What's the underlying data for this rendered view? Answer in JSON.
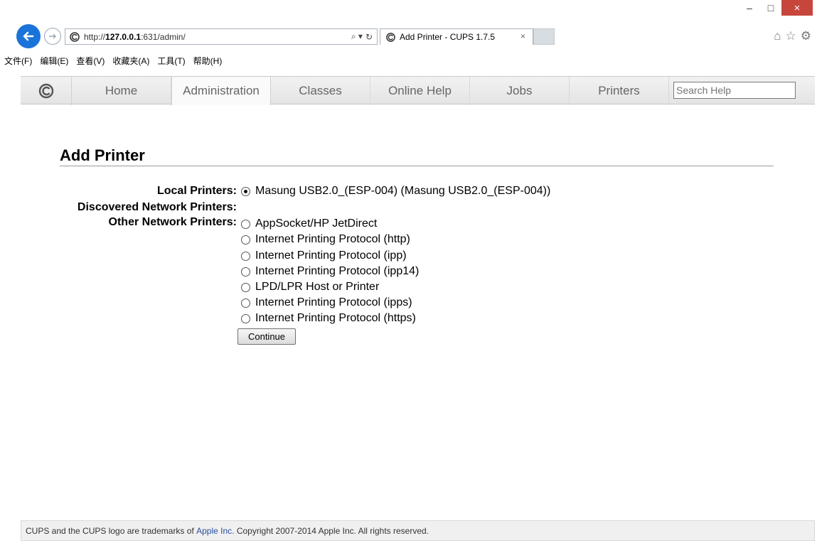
{
  "browser": {
    "url_prefix": "http://",
    "url_host": "127.0.0.1",
    "url_rest": ":631/admin/",
    "tab_title": "Add Printer - CUPS 1.7.5",
    "tab_close": "×",
    "search_tool": "⌕ ▾",
    "refresh_tool": "↻",
    "minimize": "–",
    "maximize": "□",
    "close": "×",
    "home_icon": "⌂",
    "star_icon": "☆",
    "gear_icon": "⚙"
  },
  "menu": [
    "文件(F)",
    "编辑(E)",
    "查看(V)",
    "收藏夹(A)",
    "工具(T)",
    "帮助(H)"
  ],
  "nav": {
    "tabs": [
      "Home",
      "Administration",
      "Classes",
      "Online Help",
      "Jobs",
      "Printers"
    ],
    "active": "Administration",
    "search_placeholder": "Search Help"
  },
  "page": {
    "title": "Add Printer",
    "local_label": "Local Printers:",
    "discovered_label": "Discovered Network Printers:",
    "other_label": "Other Network Printers:",
    "local_options": [
      "Masung USB2.0_(ESP-004) (Masung USB2.0_(ESP-004))"
    ],
    "other_options": [
      "AppSocket/HP JetDirect",
      "Internet Printing Protocol (http)",
      "Internet Printing Protocol (ipp)",
      "Internet Printing Protocol (ipp14)",
      "LPD/LPR Host or Printer",
      "Internet Printing Protocol (ipps)",
      "Internet Printing Protocol (https)"
    ],
    "selected": "Masung USB2.0_(ESP-004) (Masung USB2.0_(ESP-004))",
    "continue_label": "Continue"
  },
  "footer": {
    "text_before": "CUPS and the CUPS logo are trademarks of ",
    "link": "Apple Inc.",
    "text_after": " Copyright 2007-2014 Apple Inc. All rights reserved."
  }
}
